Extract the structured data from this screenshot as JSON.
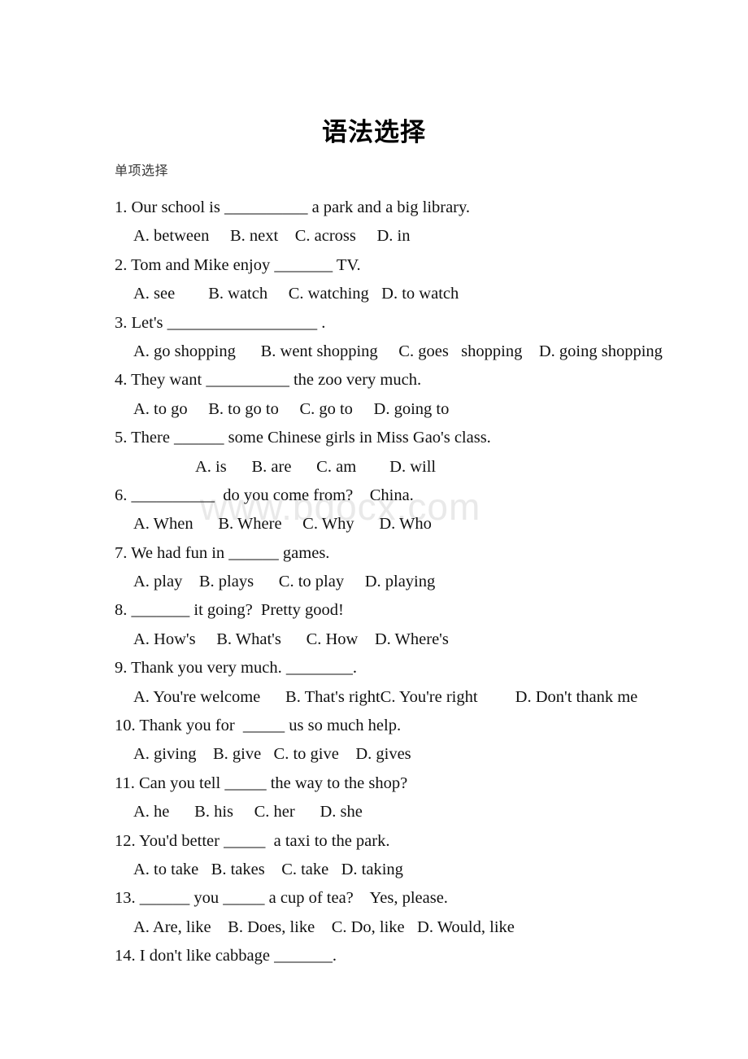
{
  "document": {
    "title": "语法选择",
    "section_label": "单项选择",
    "watermark": "www.bdocx.com"
  },
  "questions": [
    {
      "stem": "1. Our school is __________ a park and a big library.",
      "options": "A. between     B. next    C. across     D. in",
      "options_indent": "normal"
    },
    {
      "stem": "2. Tom and Mike enjoy _______ TV.",
      "options": "A. see        B. watch     C. watching   D. to watch",
      "options_indent": "normal"
    },
    {
      "stem": "3. Let's __________________ .",
      "options": "A. go shopping      B. went shopping     C. goes   shopping    D. going shopping",
      "options_indent": "normal"
    },
    {
      "stem": "4. They want __________ the zoo very much.",
      "options": "A. to go     B. to go to     C. go to     D. going to",
      "options_indent": "normal"
    },
    {
      "stem": "5. There ______ some Chinese girls in Miss Gao's class.",
      "options": "A. is      B. are      C. am        D. will",
      "options_indent": "deep"
    },
    {
      "stem": "6. __________  do you come from?    China.",
      "options": "A. When      B. Where     C. Why      D. Who",
      "options_indent": "normal"
    },
    {
      "stem": "7. We had fun in ______ games.",
      "options": "A. play    B. plays      C. to play     D. playing",
      "options_indent": "normal"
    },
    {
      "stem": "8. _______ it going?  Pretty good!",
      "options": "A. How's     B. What's      C. How    D. Where's",
      "options_indent": "normal"
    },
    {
      "stem": "9. Thank you very much. ________.",
      "options": "A. You're welcome      B. That's rightC. You're right         D. Don't thank me",
      "options_indent": "normal"
    },
    {
      "stem": "10. Thank you for  _____ us so much help.",
      "options": "A. giving    B. give   C. to give    D. gives",
      "options_indent": "normal"
    },
    {
      "stem": "11. Can you tell _____ the way to the shop?",
      "options": "A. he      B. his     C. her      D. she",
      "options_indent": "normal"
    },
    {
      "stem": "12. You'd better _____  a taxi to the park.",
      "options": "A. to take   B. takes    C. take   D. taking",
      "options_indent": "normal"
    },
    {
      "stem": "13. ______ you _____ a cup of tea?    Yes, please.",
      "options": "A. Are, like    B. Does, like    C. Do, like   D. Would, like",
      "options_indent": "normal"
    },
    {
      "stem": "14. I don't like cabbage _______.",
      "options": null,
      "options_indent": "normal"
    }
  ]
}
